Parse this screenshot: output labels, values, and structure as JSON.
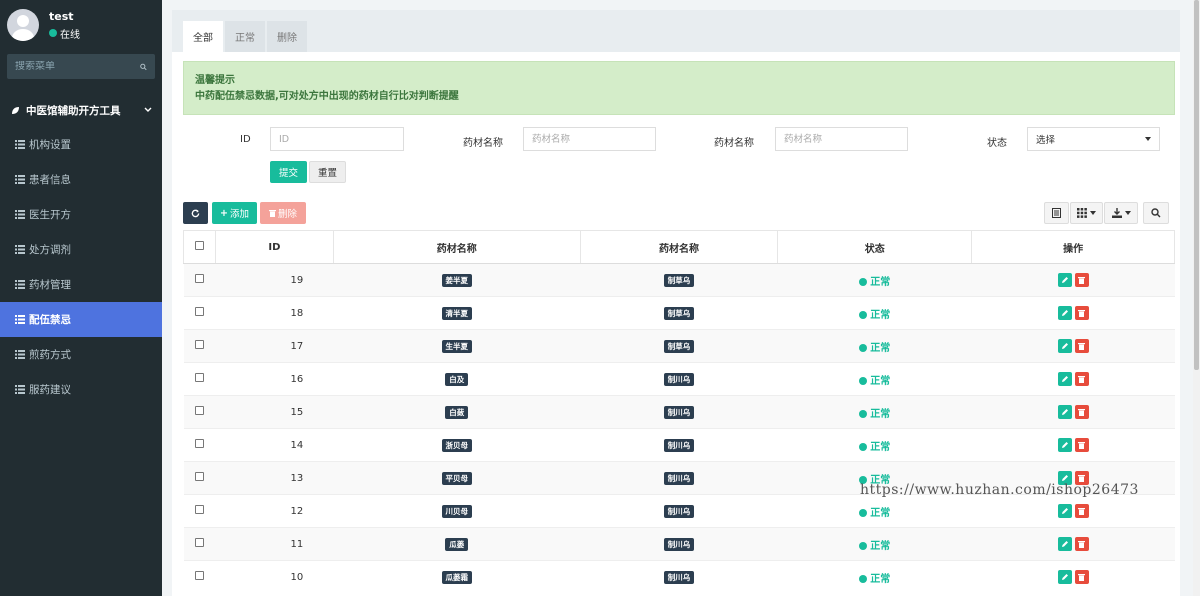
{
  "user": {
    "name": "test",
    "status": "在线"
  },
  "sidebar": {
    "search_placeholder": "搜索菜单",
    "group": "中医馆辅助开方工具",
    "items": [
      {
        "label": "机构设置"
      },
      {
        "label": "患者信息"
      },
      {
        "label": "医生开方"
      },
      {
        "label": "处方调剂"
      },
      {
        "label": "药材管理"
      },
      {
        "label": "配伍禁忌",
        "active": true
      },
      {
        "label": "煎药方式"
      },
      {
        "label": "服药建议"
      }
    ]
  },
  "tabs": [
    "全部",
    "正常",
    "删除"
  ],
  "alert": {
    "title": "温馨提示",
    "text": "中药配伍禁忌数据,可对处方中出现的药材自行比对判断提醒"
  },
  "filters": {
    "id_label": "ID",
    "id_placeholder": "ID",
    "herb1_label": "药材名称",
    "herb1_placeholder": "药材名称",
    "herb2_label": "药材名称",
    "herb2_placeholder": "药材名称",
    "status_label": "状态",
    "status_value": "选择",
    "submit": "提交",
    "reset": "重置"
  },
  "toolbar": {
    "add": "添加",
    "delete": "删除"
  },
  "table": {
    "headers": [
      "ID",
      "药材名称",
      "药材名称",
      "状态",
      "操作"
    ],
    "rows": [
      {
        "id": "19",
        "herb1": "姜半夏",
        "herb2": "制草乌",
        "status": "正常"
      },
      {
        "id": "18",
        "herb1": "清半夏",
        "herb2": "制草乌",
        "status": "正常"
      },
      {
        "id": "17",
        "herb1": "生半夏",
        "herb2": "制草乌",
        "status": "正常"
      },
      {
        "id": "16",
        "herb1": "白及",
        "herb2": "制川乌",
        "status": "正常"
      },
      {
        "id": "15",
        "herb1": "白蔹",
        "herb2": "制川乌",
        "status": "正常"
      },
      {
        "id": "14",
        "herb1": "浙贝母",
        "herb2": "制川乌",
        "status": "正常"
      },
      {
        "id": "13",
        "herb1": "平贝母",
        "herb2": "制川乌",
        "status": "正常"
      },
      {
        "id": "12",
        "herb1": "川贝母",
        "herb2": "制川乌",
        "status": "正常"
      },
      {
        "id": "11",
        "herb1": "瓜蒌",
        "herb2": "制川乌",
        "status": "正常"
      },
      {
        "id": "10",
        "herb1": "瓜蒌霜",
        "herb2": "制川乌",
        "status": "正常"
      }
    ]
  },
  "watermark": "https://www.huzhan.com/ishop26473",
  "colors": {
    "accent": "#18bc9c",
    "sidebar": "#222d32",
    "active": "#4e73df",
    "danger": "#e74c3c"
  }
}
